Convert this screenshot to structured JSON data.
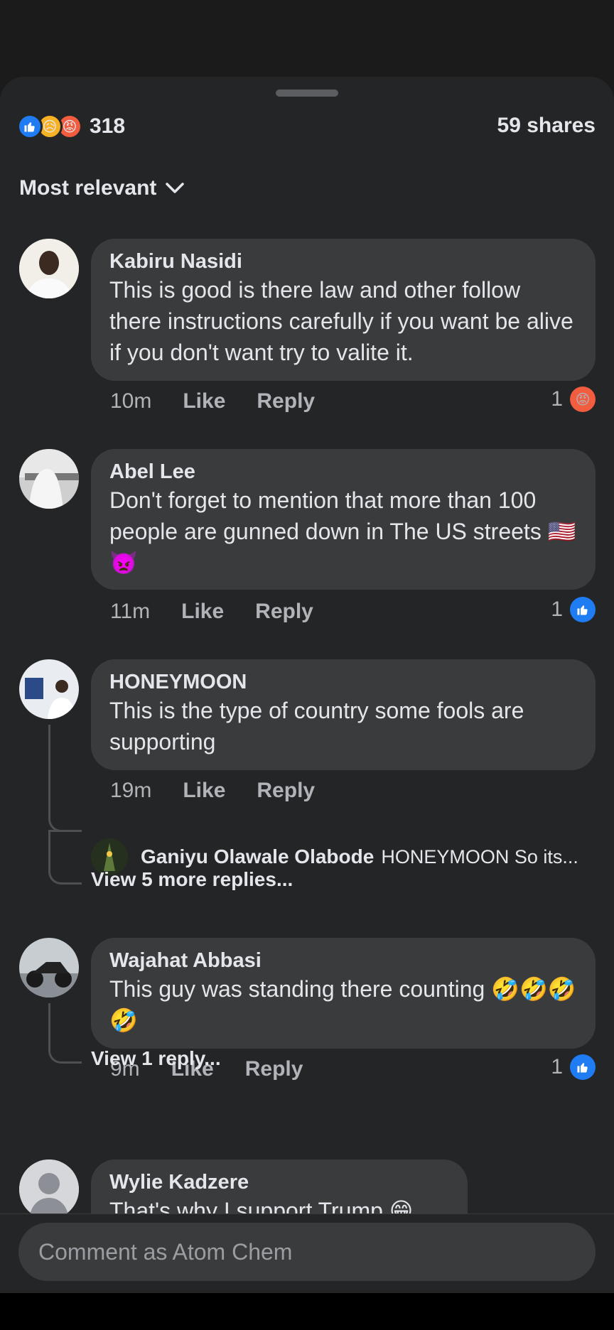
{
  "reactions": {
    "count": "318",
    "types": [
      "like-icon",
      "sad-icon",
      "angry-icon"
    ]
  },
  "shares": "59 shares",
  "sort": {
    "label": "Most relevant"
  },
  "comments": [
    {
      "name": "Kabiru Nasidi",
      "text": "This is good is there law and other follow there instructions carefully if you want be alive if you don't want try to valite it.",
      "time": "10m",
      "like": "Like",
      "reply": "Reply",
      "reaction_count": "1",
      "reaction": "angry-icon"
    },
    {
      "name": "Abel Lee",
      "text": "Don't forget to mention that more than 100 people are gunned down in The US streets 🇺🇸👿",
      "time": "11m",
      "like": "Like",
      "reply": "Reply",
      "reaction_count": "1",
      "reaction": "like-icon"
    },
    {
      "name": "HONEYMOON",
      "text": "This is the type of country some fools are supporting",
      "time": "19m",
      "like": "Like",
      "reply": "Reply",
      "reply_preview": {
        "name": "Ganiyu Olawale Olabode",
        "text": "HONEYMOON So its..."
      },
      "view_more": "View 5 more replies..."
    },
    {
      "name": "Wajahat Abbasi",
      "text": "This guy was standing there counting 🤣🤣🤣🤣",
      "time": "9m",
      "like": "Like",
      "reply": "Reply",
      "reaction_count": "1",
      "reaction": "like-icon",
      "view_more": "View 1 reply..."
    },
    {
      "name": "Wylie Kadzere",
      "text": "That's why I support Trump 😁"
    }
  ],
  "input": {
    "placeholder": "Comment as Atom Chem"
  },
  "colors": {
    "like_blue": "#1f7cf2",
    "angry_orange": "#f25c3f",
    "bubble": "#3a3b3c",
    "sheet": "#242526"
  }
}
